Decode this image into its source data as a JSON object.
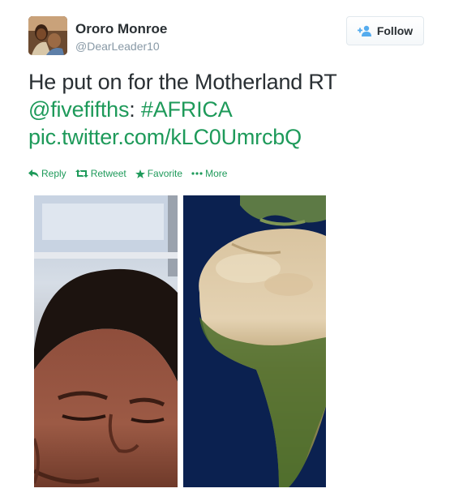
{
  "tweet": {
    "author": {
      "display_name": "Ororo Monroe",
      "handle": "@DearLeader10",
      "avatar_icon": "avatar-photo"
    },
    "follow_button": {
      "label": "Follow",
      "icon": "add-user-icon"
    },
    "text": {
      "plain": "He put on for the Motherland RT",
      "mention": "@fivefifths",
      "separator": ":",
      "hashtag": "#AFRICA",
      "pic_link": "pic.twitter.com/kLC0UmrcbQ"
    },
    "actions": [
      {
        "label": "Reply",
        "icon": "reply-icon"
      },
      {
        "label": "Retweet",
        "icon": "retweet-icon"
      },
      {
        "label": "Favorite",
        "icon": "star-icon"
      },
      {
        "label": "More",
        "icon": "more-dots-icon"
      }
    ],
    "media": [
      {
        "name": "face-closeup-photo"
      },
      {
        "name": "africa-satellite-map"
      }
    ]
  },
  "colors": {
    "link": "#1e9a5a",
    "text": "#292f33",
    "muted": "#8899a6",
    "follow_icon": "#55acee"
  }
}
